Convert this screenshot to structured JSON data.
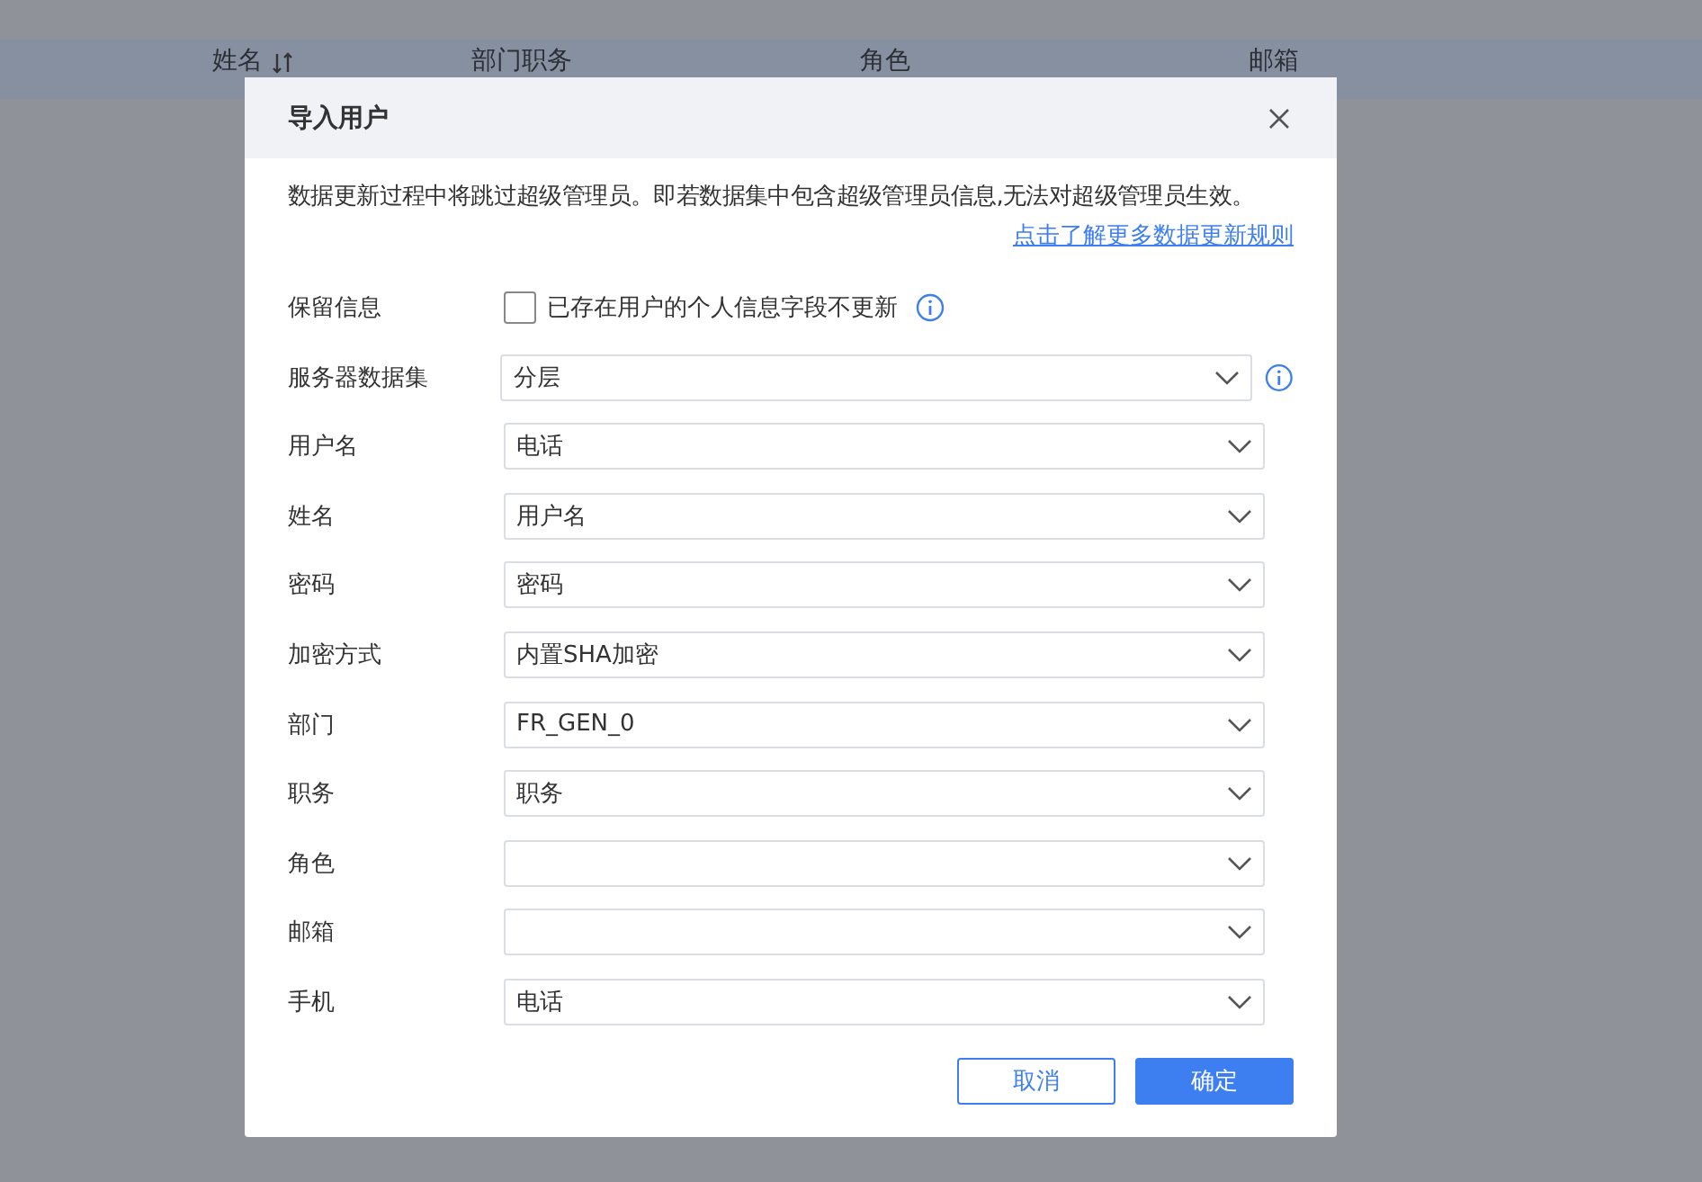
{
  "table": {
    "columns": [
      {
        "label": "姓名",
        "sortable": true
      },
      {
        "label": "部门职务",
        "sortable": false
      },
      {
        "label": "角色",
        "sortable": false
      },
      {
        "label": "邮箱",
        "sortable": false
      }
    ]
  },
  "dialog": {
    "title": "导入用户",
    "notice": "数据更新过程中将跳过超级管理员。即若数据集中包含超级管理员信息,无法对超级管理员生效。",
    "link": "点击了解更多数据更新规则",
    "fields": [
      {
        "kind": "checkbox",
        "label": "保留信息",
        "text": "已存在用户的个人信息字段不更新",
        "checked": false,
        "info": true
      },
      {
        "kind": "select",
        "label": "服务器数据集",
        "value": "分层",
        "info": true
      },
      {
        "kind": "select",
        "label": "用户名",
        "value": "电话",
        "info": false
      },
      {
        "kind": "select",
        "label": "姓名",
        "value": "用户名",
        "info": false
      },
      {
        "kind": "select",
        "label": "密码",
        "value": "密码",
        "info": false
      },
      {
        "kind": "select",
        "label": "加密方式",
        "value": "内置SHA加密",
        "info": false
      },
      {
        "kind": "select",
        "label": "部门",
        "value": "FR_GEN_0",
        "info": false
      },
      {
        "kind": "select",
        "label": "职务",
        "value": "职务",
        "info": false
      },
      {
        "kind": "select",
        "label": "角色",
        "info": false
      },
      {
        "kind": "select",
        "label": "邮箱",
        "info": false
      },
      {
        "kind": "select",
        "label": "手机",
        "value": "电话",
        "info": false
      }
    ],
    "buttons": [
      {
        "label": "取消",
        "kind": "secondary"
      },
      {
        "label": "确定",
        "kind": "primary"
      }
    ]
  }
}
